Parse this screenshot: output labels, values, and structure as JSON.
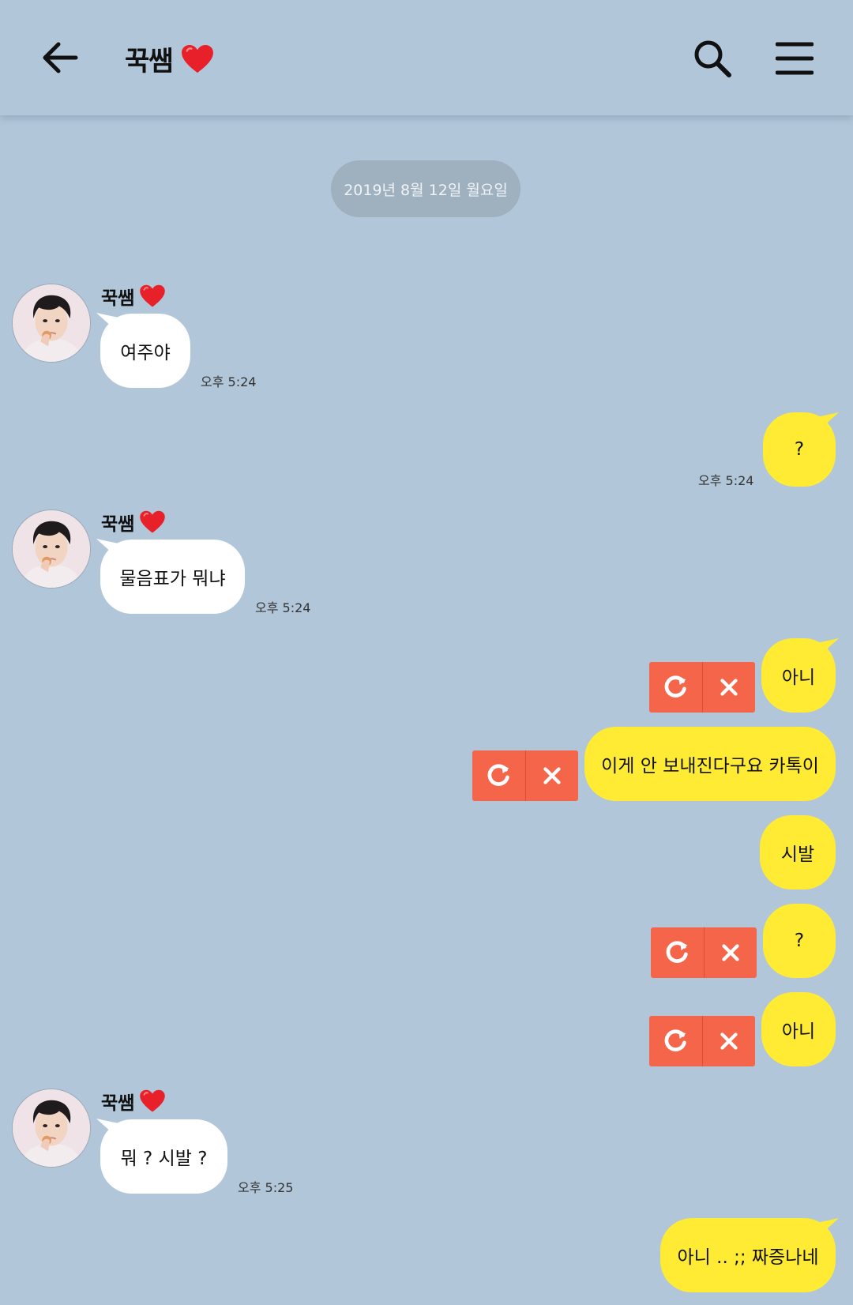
{
  "header": {
    "title": "꾹쌤",
    "back_icon": "arrow-left-icon",
    "search_icon": "search-icon",
    "menu_icon": "hamburger-menu-icon"
  },
  "date_divider": "2019년 8월 12일 월요일",
  "colors": {
    "background": "#b1c6d9",
    "incoming_bubble": "#ffffff",
    "outgoing_bubble": "#ffeb33",
    "failed_action": "#f5654a",
    "heart": "#e8202a"
  },
  "messages": [
    {
      "direction": "in",
      "sender": "꾹쌤",
      "text": "여주야",
      "time": "오후 5:24"
    },
    {
      "direction": "out",
      "text": "?",
      "time": "오후 5:24"
    },
    {
      "direction": "in",
      "sender": "꾹쌤",
      "text": "물음표가 뭐냐",
      "time": "오후 5:24"
    },
    {
      "direction": "out",
      "text": "아니",
      "status": "failed"
    },
    {
      "direction": "out",
      "text": "이게 안 보내진다구요 카톡이",
      "status": "failed"
    },
    {
      "direction": "out",
      "text": "시발"
    },
    {
      "direction": "out",
      "text": "?",
      "status": "failed"
    },
    {
      "direction": "out",
      "text": "아니",
      "status": "failed"
    },
    {
      "direction": "in",
      "sender": "꾹쌤",
      "text": "뭐 ? 시발 ?",
      "time": "오후 5:25"
    },
    {
      "direction": "out",
      "text": "아니 .. ;; 짜증나네"
    }
  ],
  "failed_actions": {
    "resend_icon": "resend-icon",
    "delete_icon": "delete-x-icon"
  }
}
